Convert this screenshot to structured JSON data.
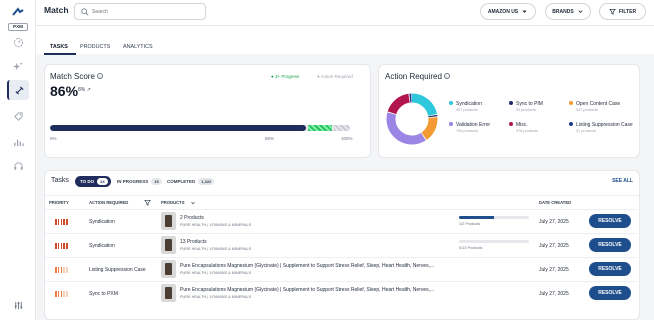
{
  "brand": {
    "logo_text": "PXM"
  },
  "header": {
    "title": "Match",
    "search_placeholder": "Search",
    "marketplace": "AMAZON US",
    "brands": "BRANDS",
    "filter": "FILTER"
  },
  "tabs": [
    "TASKS",
    "PRODUCTS",
    "ANALYTICS"
  ],
  "match_score": {
    "title": "Match Score",
    "value": "86%",
    "delta": "8%",
    "legend_progress": "3+ Progress",
    "legend_action": "Action Required",
    "progress_fraction": 0.86,
    "ticks": [
      "0%",
      "86%",
      "100%"
    ]
  },
  "action_required": {
    "title": "Action Required",
    "items": [
      {
        "label": "Syndication",
        "sub": "457 products",
        "color": "#2ec7dc"
      },
      {
        "label": "Sync to PIM",
        "sub": "30 products",
        "color": "#1e2b6b"
      },
      {
        "label": "Open Content Case",
        "sub": "347 products",
        "color": "#f39a33"
      },
      {
        "label": "Validation Error",
        "sub": "796 products",
        "color": "#9b86e6"
      },
      {
        "label": "Misc.",
        "sub": "378 products",
        "color": "#b0154d"
      },
      {
        "label": "Listing Suppression Case",
        "sub": "37 products",
        "color": "#1f3a8a"
      }
    ]
  },
  "tasks": {
    "title": "Tasks",
    "chips": [
      {
        "label": "TO DO",
        "count": "24"
      },
      {
        "label": "IN PROGRESS",
        "count": "15"
      },
      {
        "label": "COMPLETED",
        "count": "1,322"
      }
    ],
    "see_all": "SEE ALL",
    "columns": [
      "PRIORITY",
      "ACTION REQUIRED",
      "PRODUCTS",
      "DATE CREATED"
    ],
    "rows": [
      {
        "action": "Syndication",
        "product": "2 Products",
        "sub": "PURE HEALTH  |  VITAMINS & MINERALS",
        "progress": "1/2 Products",
        "progress_fraction": 0.5,
        "date": "July 27, 2025",
        "button": "RESOLVE",
        "priority_color": "#d14a2a"
      },
      {
        "action": "Syndication",
        "product": "13 Products",
        "sub": "PURE HEALTH  |  VITAMINS & MINERALS",
        "progress": "0/13 Products",
        "progress_fraction": 0.0,
        "date": "July 27, 2025",
        "button": "RESOLVE",
        "priority_color": "#d14a2a"
      },
      {
        "action": "Listing Suppression Case",
        "product": "Pure Encapsulations Magnesium (Glycinate) | Supplement to Support Stress Relief, Sleep, Heart Health, Nerves,...",
        "sub": "PURE HEALTH  |  VITAMINS & MINERALS",
        "progress": "",
        "progress_fraction": null,
        "date": "July 27, 2025",
        "button": "RESOLVE",
        "priority_color": "#ef7a3b"
      },
      {
        "action": "Sync to PXM",
        "product": "Pure Encapsulations Magnesium (Glycinate) | Supplement to Support Stress Relief, Sleep, Heart Health, Nerves,...",
        "sub": "PURE HEALTH  |  VITAMINS & MINERALS",
        "progress": "",
        "progress_fraction": null,
        "date": "July 27, 2025",
        "button": "RESOLVE",
        "priority_color": "#ef7a3b"
      }
    ]
  }
}
